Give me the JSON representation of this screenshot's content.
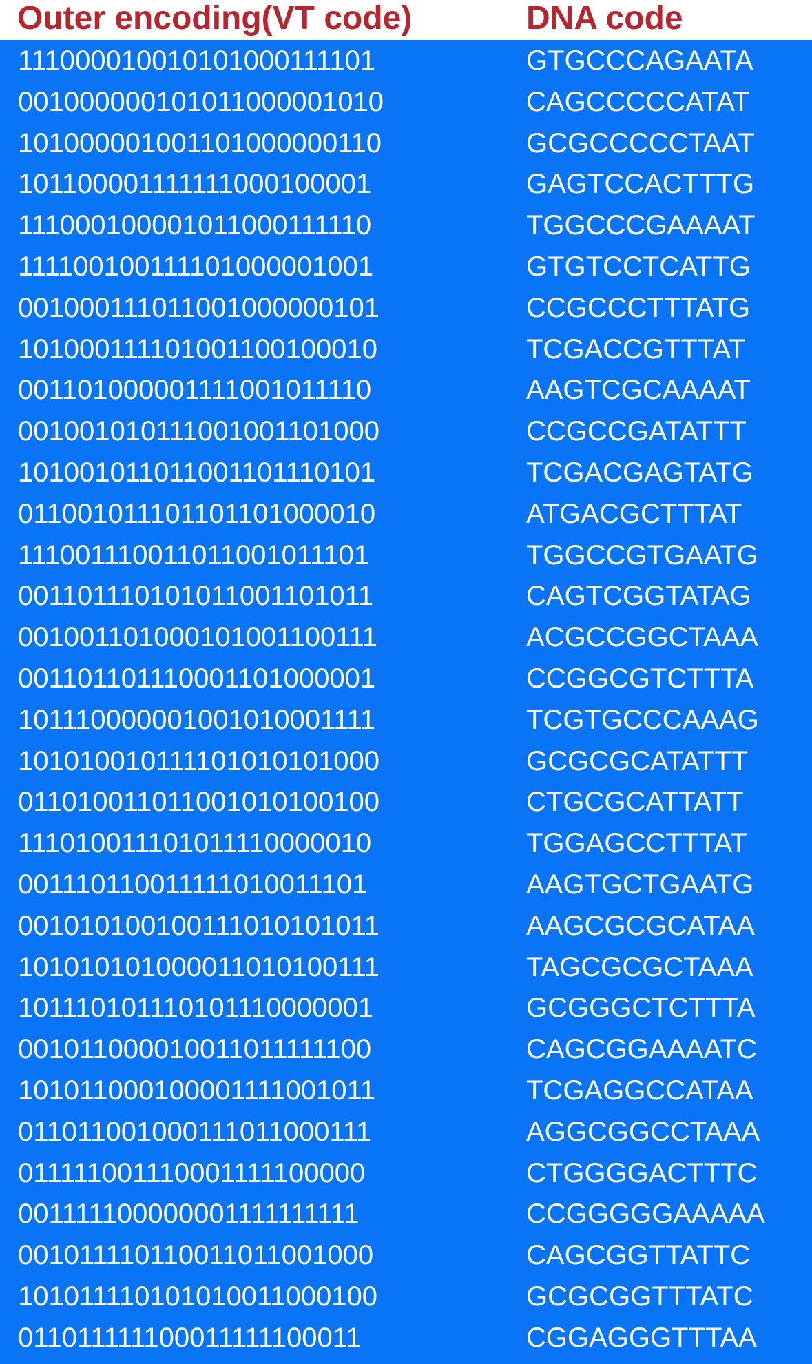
{
  "header": {
    "left_title": "Outer encoding(VT code)",
    "right_title": "DNA code"
  },
  "colors": {
    "header_text": "#b5262f",
    "table_background": "#0a74f7",
    "cell_text": "#ffffff"
  },
  "rows": [
    {
      "vt": "1110000100101010001111 01",
      "dna": "GTGCCCAGAATA"
    },
    {
      "vt": "001000000101011000001010",
      "dna": "CAGCCCCCATAT"
    },
    {
      "vt": "101000001001101000000110",
      "dna": "GCGCCCCCTAAT"
    },
    {
      "vt": "101100001111111000100001",
      "dna": "GAGTCCACTTTG"
    },
    {
      "vt": "111000100001011000111110",
      "dna": "TGGCCCGAAAAT"
    },
    {
      "vt": "111100100111101000001001",
      "dna": "GTGTCCTCATTG"
    },
    {
      "vt": "001000111011001000000101",
      "dna": "CCGCCCTTTATG"
    },
    {
      "vt": "101000111101001100100010",
      "dna": "TCGACCGTTTAT"
    },
    {
      "vt": "001101000001111001011110",
      "dna": "AAGTCGCAAAAT"
    },
    {
      "vt": "001001010111001001101000",
      "dna": "CCGCCGATATTT"
    },
    {
      "vt": "101001011011001101110101",
      "dna": "TCGACGAGTATG"
    },
    {
      "vt": "011001011101101101000010",
      "dna": "ATGACGCTTTAT"
    },
    {
      "vt": "111001110011011001011101",
      "dna": "TGGCCGTGAATG"
    },
    {
      "vt": "001101110101011001101011",
      "dna": "CAGTCGGTATAG"
    },
    {
      "vt": "001001101000101001100111",
      "dna": "ACGCCGGCTAAA"
    },
    {
      "vt": "001101101110001101000001",
      "dna": "CCGGCGTCTTTA"
    },
    {
      "vt": "101110000001001010001111",
      "dna": "TCGTGCCCAAAG"
    },
    {
      "vt": "101010010111101010101000",
      "dna": "GCGCGCATATTT"
    },
    {
      "vt": "011010011011001010100100",
      "dna": "CTGCGCATTATT"
    },
    {
      "vt": "111010011101011110000010",
      "dna": "TGGAGCCTTTAT"
    },
    {
      "vt": "001110110011111010011101",
      "dna": "AAGTGCTGAATG"
    },
    {
      "vt": "001010100100111010101011",
      "dna": "AAGCGCGCATAA"
    },
    {
      "vt": "101010101000011010100111",
      "dna": "TAGCGCGCTAAA"
    },
    {
      "vt": "101110101110101110000001",
      "dna": "GCGGGCTCTTTA"
    },
    {
      "vt": "001011000010011011111100",
      "dna": "CAGCGGAAAATC"
    },
    {
      "vt": "101011000100001111001011",
      "dna": "TCGAGGCCATAA"
    },
    {
      "vt": "011011001000111011000111",
      "dna": "AGGCGGCCTAAA"
    },
    {
      "vt": "011111001110001111100000",
      "dna": "CTGGGGACTTTC"
    },
    {
      "vt": "001111100000001111111111",
      "dna": "CCGGGGGAAAAA"
    },
    {
      "vt": "001011110110011011001000",
      "dna": "CAGCGGTTATTC"
    },
    {
      "vt": "101011110101010011000100",
      "dna": "GCGCGGTTTATC"
    },
    {
      "vt": "011011111100011111100011",
      "dna": "CGGAGGGTTTAA"
    }
  ]
}
